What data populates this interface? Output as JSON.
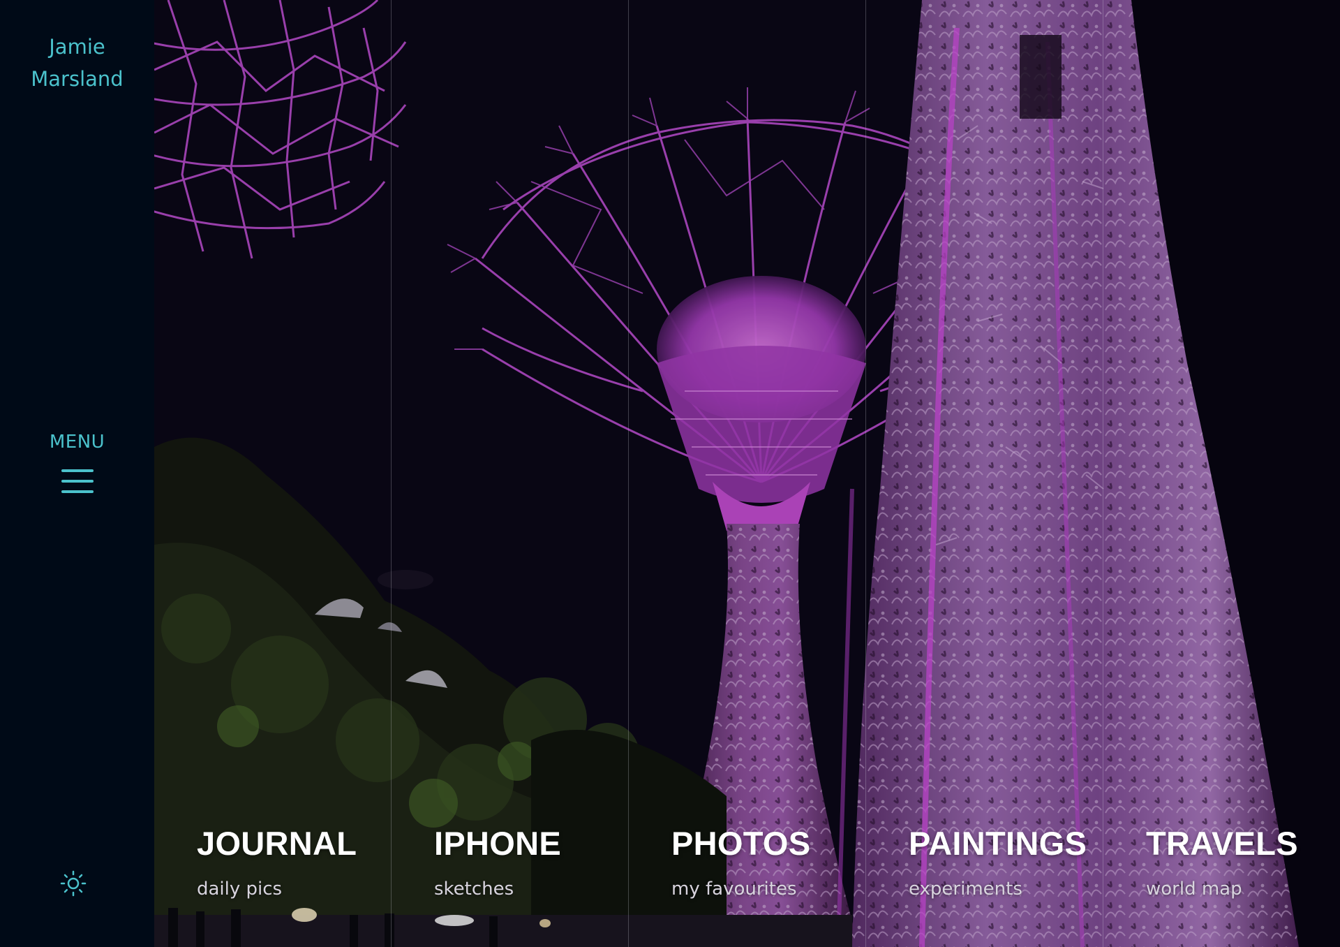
{
  "site": {
    "owner_first": "Jamie",
    "owner_last": "Marsland"
  },
  "sidebar": {
    "menu_label": "MENU",
    "menu_icon": "hamburger-icon",
    "theme_icon": "sun-icon"
  },
  "hero": {
    "background": "night-supertree-garden-photo"
  },
  "nav": [
    {
      "title": "JOURNAL",
      "subtitle": "daily pics"
    },
    {
      "title": "IPHONE",
      "subtitle": "sketches"
    },
    {
      "title": "PHOTOS",
      "subtitle": "my favourites"
    },
    {
      "title": "PAINTINGS",
      "subtitle": "experiments"
    },
    {
      "title": "TRAVELS",
      "subtitle": "world map"
    }
  ],
  "colors": {
    "sidebar_bg": "#000a17",
    "accent": "#4bc2cc",
    "sky": "#0b0716",
    "supertree_glow": "#b448c8",
    "foliage": "#9a6aae"
  }
}
